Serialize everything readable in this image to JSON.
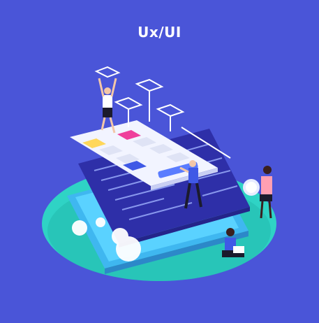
{
  "title": "Ux/UI",
  "colors": {
    "background": "#4a55d8",
    "platform": "#2fd3c5",
    "card": "#f2f4ff",
    "code_panel": "#2e2fa8",
    "accent_pink": "#ef3f9b",
    "accent_yellow": "#ffd75a",
    "accent_blue": "#3f59e6"
  },
  "illustration": {
    "people": [
      "woman-holding-frame",
      "man-pointing",
      "woman-holding-gear",
      "man-with-laptop"
    ],
    "objects": [
      "ui-card",
      "code-panel",
      "phone-base",
      "gears",
      "wireframe-tiles"
    ]
  }
}
